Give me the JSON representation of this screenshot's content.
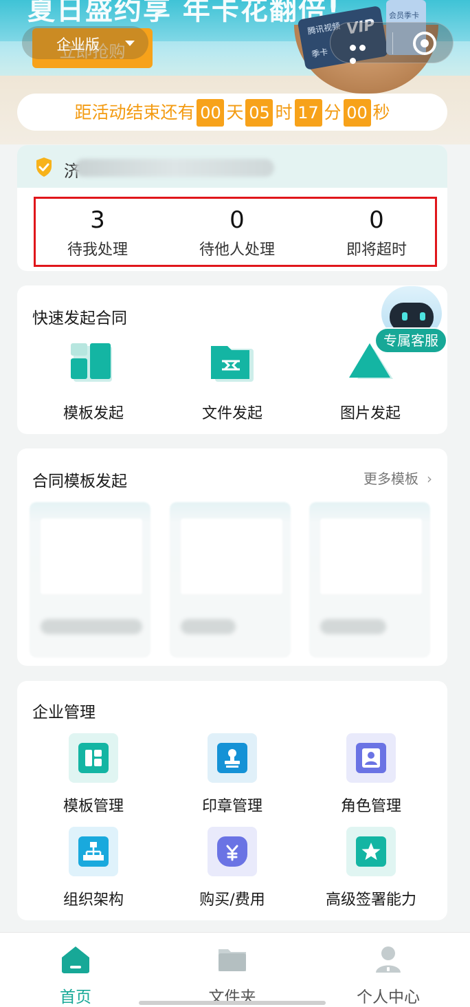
{
  "banner": {
    "title": "夏日盛约享 年卡花翻倍!",
    "buy_label": "立即抢购",
    "edition_label": "企业版",
    "card_brand": "腾讯视频",
    "card_vip": "VIP",
    "card_season": "季卡",
    "card2_label": "会员季卡"
  },
  "countdown": {
    "prefix": "距活动结束还有",
    "days": "00",
    "days_unit": "天",
    "hours": "05",
    "hours_unit": "时",
    "minutes": "17",
    "minutes_unit": "分",
    "seconds": "00",
    "seconds_unit": "秒"
  },
  "company": {
    "name_initial": "济"
  },
  "stats": [
    {
      "value": "3",
      "label": "待我处理"
    },
    {
      "value": "0",
      "label": "待他人处理"
    },
    {
      "value": "0",
      "label": "即将超时"
    }
  ],
  "quick": {
    "title": "快速发起合同",
    "items": [
      {
        "label": "模板发起",
        "icon": "template-icon"
      },
      {
        "label": "文件发起",
        "icon": "folder-icon"
      },
      {
        "label": "图片发起",
        "icon": "image-icon"
      }
    ]
  },
  "service": {
    "label": "专属客服"
  },
  "templates": {
    "title": "合同模板发起",
    "more_label": "更多模板",
    "more_chevron": "›"
  },
  "management": {
    "title": "企业管理",
    "items": [
      {
        "label": "模板管理",
        "icon": "template-manage-icon",
        "color": "#14b5a3",
        "bg": "#e0f5f2"
      },
      {
        "label": "印章管理",
        "icon": "seal-icon",
        "color": "#1592d6",
        "bg": "#e0f0f9"
      },
      {
        "label": "角色管理",
        "icon": "role-icon",
        "color": "#6a73e4",
        "bg": "#e9eafb"
      },
      {
        "label": "组织架构",
        "icon": "org-chart-icon",
        "color": "#19a9dd",
        "bg": "#dff2fb"
      },
      {
        "label": "购买/费用",
        "icon": "purchase-icon",
        "color": "#6a73e4",
        "bg": "#e9eafb"
      },
      {
        "label": "高级签署能力",
        "icon": "star-icon",
        "color": "#14b5a3",
        "bg": "#e0f5f2"
      }
    ]
  },
  "tabbar": [
    {
      "label": "首页",
      "icon": "home-icon",
      "active": true
    },
    {
      "label": "文件夹",
      "icon": "folder-tab-icon",
      "active": false
    },
    {
      "label": "个人中心",
      "icon": "person-icon",
      "active": false
    }
  ],
  "colors": {
    "accent": "#17a897",
    "orange": "#f7a21a",
    "highlight": "#e0161b"
  }
}
